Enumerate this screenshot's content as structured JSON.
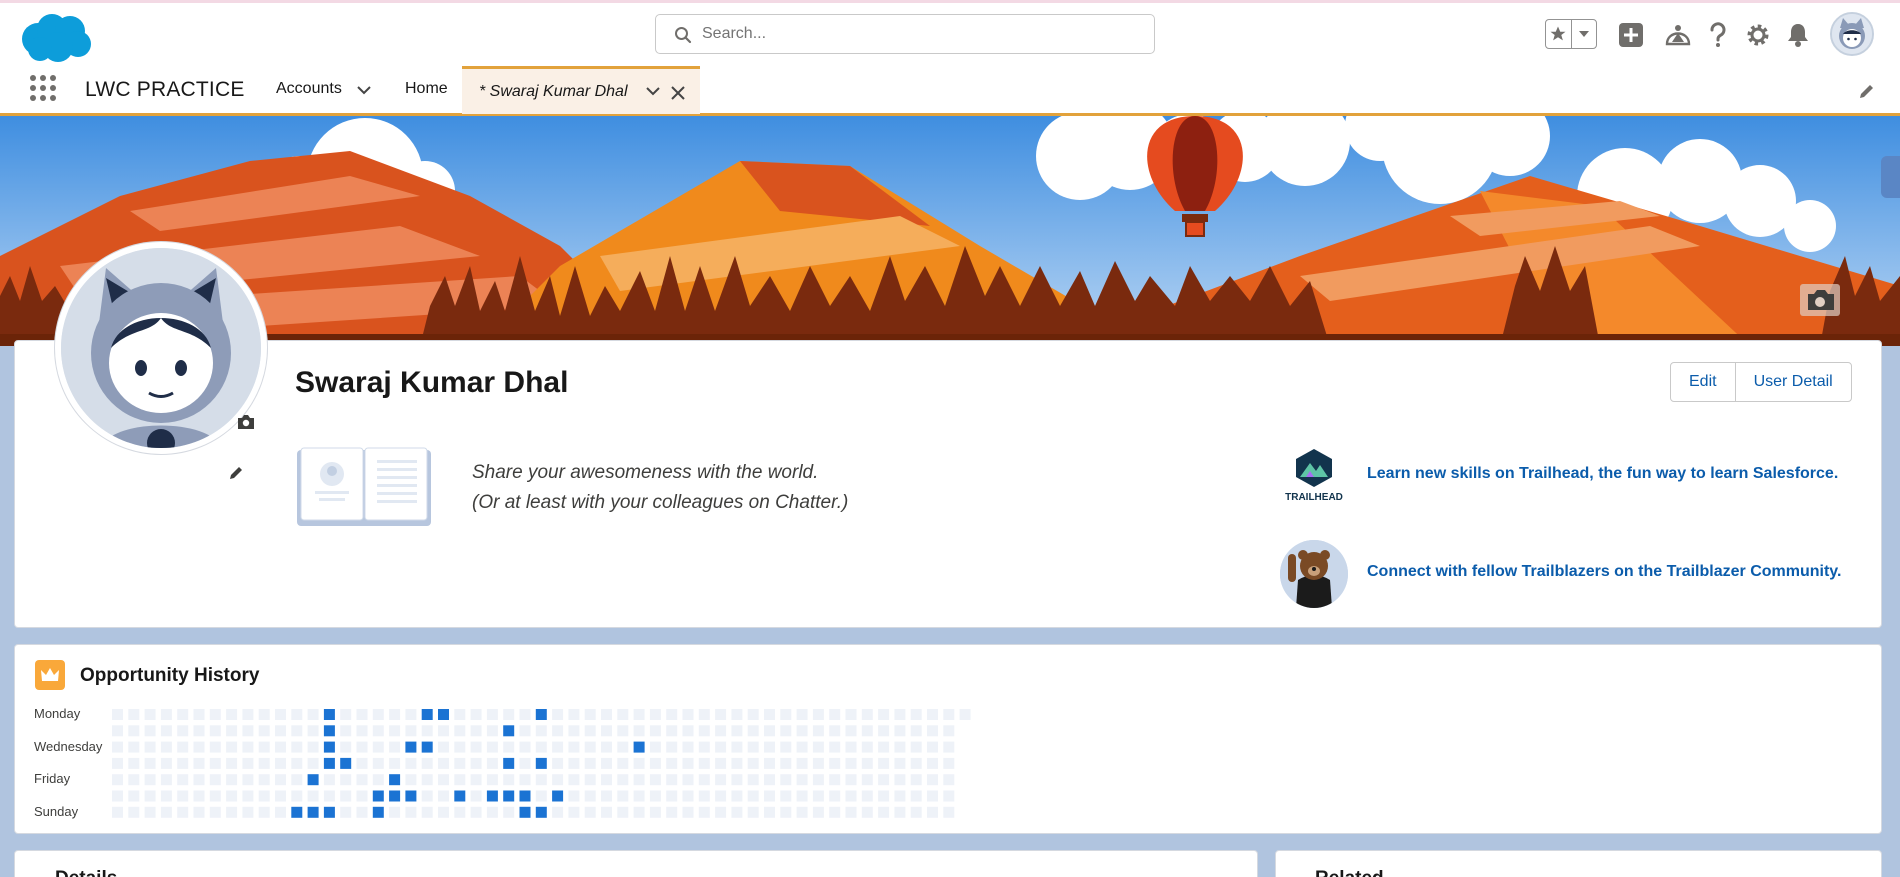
{
  "header": {
    "search_placeholder": "Search...",
    "icons": [
      "favorites-star-icon",
      "favorites-menu-icon",
      "global-create-icon",
      "trailhead-guidance-icon",
      "help-icon",
      "setup-gear-icon",
      "notifications-bell-icon",
      "user-avatar"
    ]
  },
  "nav": {
    "app_name": "LWC PRACTICE",
    "items": [
      {
        "label": "Accounts"
      },
      {
        "label": "Home"
      }
    ],
    "active_tab": {
      "label": "* Swaraj Kumar Dhal"
    }
  },
  "profile": {
    "name": "Swaraj Kumar Dhal",
    "edit_label": "Edit",
    "user_detail_label": "User Detail",
    "share_line1": "Share your awesomeness with the world.",
    "share_line2": "(Or at least with your colleagues on Chatter.)",
    "trailhead_logo_text": "TRAILHEAD",
    "trailhead_link": "Learn new skills on Trailhead, the fun way to learn Salesforce.",
    "trailblazer_link": "Connect with fellow Trailblazers on the Trailblazer Community."
  },
  "opportunity_history": {
    "title": "Opportunity History",
    "day_labels": [
      "Monday",
      "Wednesday",
      "Friday",
      "Sunday"
    ],
    "rows": 7,
    "columns": 53,
    "active_cells": [
      [
        0,
        13
      ],
      [
        0,
        19
      ],
      [
        0,
        20
      ],
      [
        0,
        26
      ],
      [
        1,
        13
      ],
      [
        1,
        24
      ],
      [
        2,
        13
      ],
      [
        2,
        18
      ],
      [
        2,
        19
      ],
      [
        2,
        32
      ],
      [
        3,
        13
      ],
      [
        3,
        14
      ],
      [
        3,
        24
      ],
      [
        3,
        26
      ],
      [
        4,
        12
      ],
      [
        4,
        17
      ],
      [
        5,
        16
      ],
      [
        5,
        17
      ],
      [
        5,
        18
      ],
      [
        5,
        21
      ],
      [
        5,
        23
      ],
      [
        5,
        24
      ],
      [
        5,
        25
      ],
      [
        5,
        27
      ],
      [
        6,
        11
      ],
      [
        6,
        12
      ],
      [
        6,
        13
      ],
      [
        6,
        16
      ],
      [
        6,
        25
      ],
      [
        6,
        26
      ]
    ],
    "colors": {
      "empty": "#eef2f8",
      "active": "#1b73d3"
    }
  },
  "bottom": {
    "details_title": "Details",
    "related_title": "Related"
  },
  "colors": {
    "brand_blue": "#0b5cab",
    "tab_accent": "#e2a23b",
    "page_bg": "#b0c4df"
  }
}
